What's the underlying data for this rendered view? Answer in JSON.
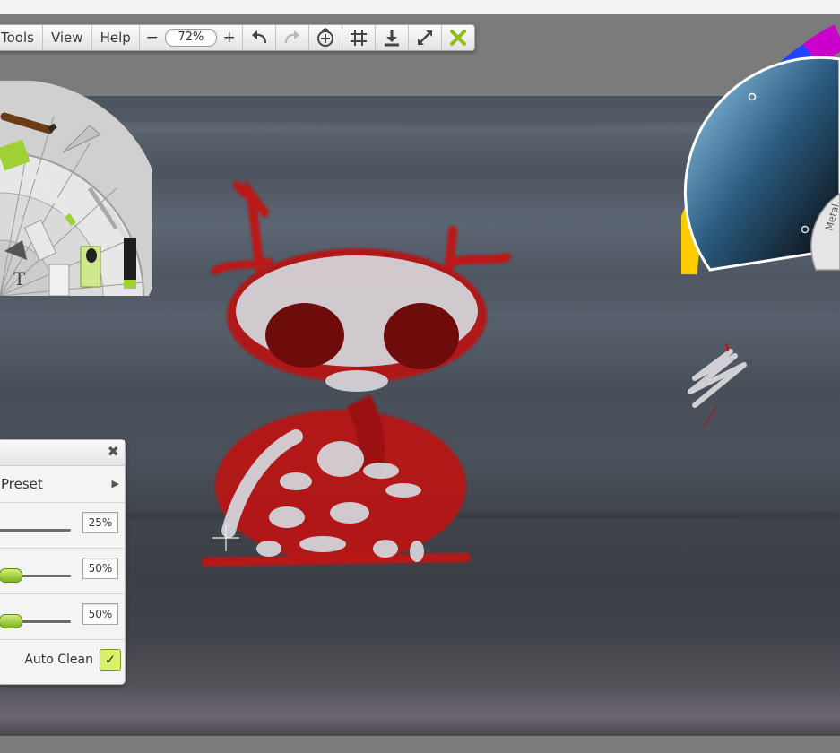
{
  "toolbar": {
    "menus": [
      "Tools",
      "View",
      "Help"
    ],
    "zoom_out": "−",
    "zoom_value": "72%",
    "zoom_in": "+",
    "icons": [
      "undo-icon",
      "redo-icon",
      "add-layer-icon",
      "grid-icon",
      "download-icon",
      "fullscreen-icon",
      "close-icon"
    ]
  },
  "colorwheel": {
    "label": "Metal"
  },
  "panel": {
    "close": "✖",
    "preset_label": "Preset",
    "preset_arrow": "▶",
    "sliders": [
      {
        "value_text": "25%",
        "value": 0.25
      },
      {
        "value_text": "50%",
        "value": 0.5
      },
      {
        "value_text": "50%",
        "value": 0.5
      }
    ],
    "auto_clean_label": "Auto Clean",
    "auto_clean_check": "✓",
    "auto_clean_checked": true
  },
  "colors": {
    "accent_green": "#9ccc2e",
    "paint_red": "#c41414",
    "paint_white": "#d9d9dc"
  }
}
